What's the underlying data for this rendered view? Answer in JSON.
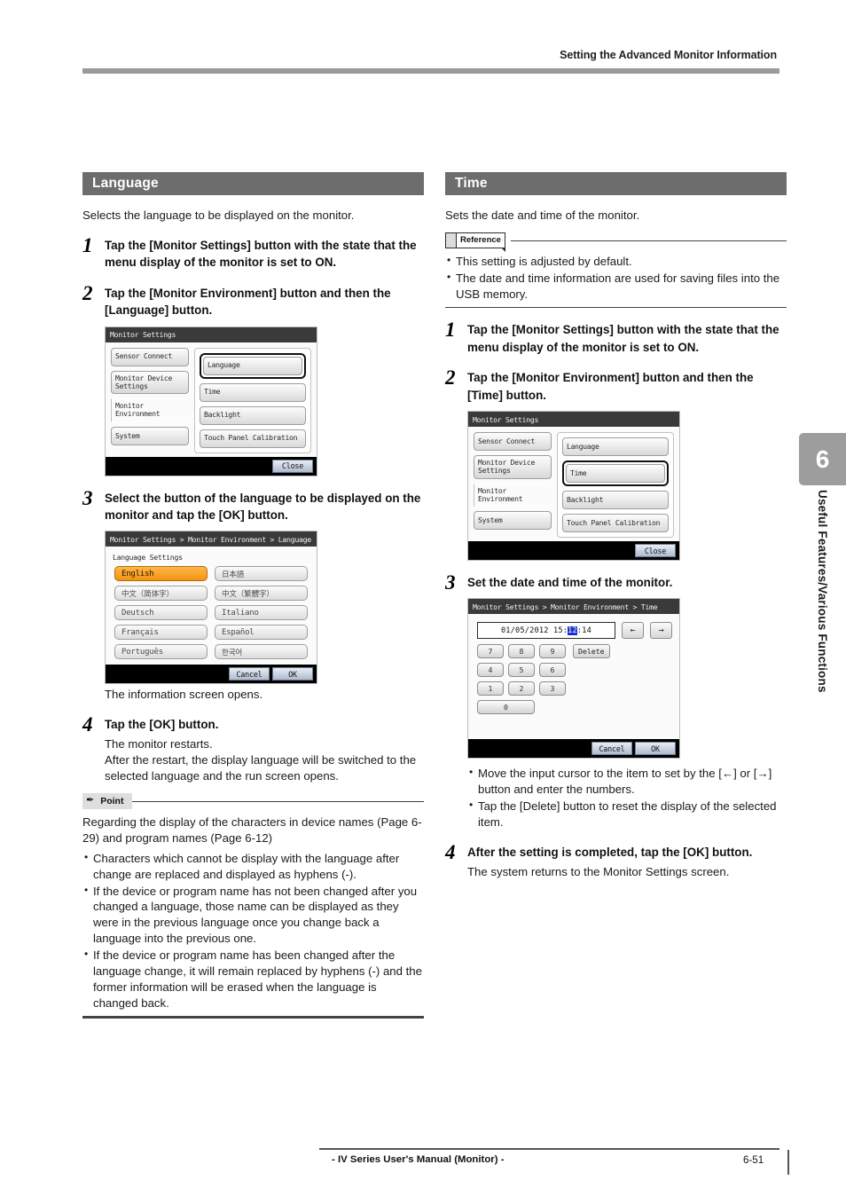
{
  "header": {
    "title": "Setting the Advanced Monitor Information"
  },
  "footer": {
    "center": "- IV Series User's Manual (Monitor) -",
    "page": "6-51"
  },
  "chapter_tab": {
    "number": "6",
    "label": "Useful Features/Various Functions"
  },
  "left": {
    "section_title": "Language",
    "intro": "Selects the language to be displayed on the monitor.",
    "steps": [
      {
        "num": "1",
        "title": "Tap the [Monitor Settings] button with the state that the menu display of the monitor is set to ON."
      },
      {
        "num": "2",
        "title": "Tap the [Monitor Environment] button and then the [Language] button."
      },
      {
        "num": "3",
        "title": "Select the button of the language to be displayed on the monitor and tap the [OK] button.",
        "after": "The information screen opens."
      },
      {
        "num": "4",
        "title": "Tap the [OK] button.",
        "body": "The monitor restarts.\nAfter the restart, the display language will be switched to the selected language and the run screen opens."
      }
    ],
    "point": {
      "tag": "Point",
      "icon": "pencil-icon",
      "paragraph": "Regarding the display of the characters in device names (Page 6-29) and program names (Page 6-12)",
      "bullets": [
        "Characters which cannot be display with the language after change are replaced and displayed as hyphens (-).",
        "If the device or program name has not been changed after you changed a language, those name can be displayed as they were in the previous language once you change back a language into the previous one.",
        "If the device or program name has been changed after the language change, it will remain replaced by hyphens (-) and the former information will be erased when the language is changed back."
      ]
    }
  },
  "right": {
    "section_title": "Time",
    "intro": "Sets the date and time of the monitor.",
    "reference": {
      "tag": "Reference",
      "bullets": [
        "This setting is adjusted by default.",
        "The date and time information are used for saving files into the USB memory."
      ]
    },
    "steps": [
      {
        "num": "1",
        "title": "Tap the [Monitor Settings] button with the state that the menu display of the monitor is set to ON."
      },
      {
        "num": "2",
        "title": "Tap the [Monitor Environment] button and then the [Time] button."
      },
      {
        "num": "3",
        "title": "Set the date and time of the monitor."
      },
      {
        "num": "4",
        "title": "After the setting is completed, tap the [OK] button.",
        "body": "The system returns to the Monitor Settings screen."
      }
    ],
    "time_notes": [
      "Move the input cursor to the item to set by the [←] or [→] button and enter the numbers.",
      "Tap the [Delete] button to reset the display of the selected item."
    ]
  },
  "device_menu": {
    "titlebar": "Monitor Settings",
    "left_buttons": [
      "Sensor Connect",
      "Monitor Device Settings",
      "Monitor Environment",
      "System"
    ],
    "right_buttons": [
      "Language",
      "Time",
      "Backlight",
      "Touch Panel Calibration"
    ],
    "close_label": "Close",
    "selected_left": "Monitor Environment",
    "selected_right_language": "Language",
    "selected_right_time": "Time"
  },
  "device_language": {
    "titlebar": "Monitor Settings > Monitor Environment > Language",
    "subtitle": "Language Settings",
    "options": [
      "English",
      "日本語",
      "中文（简体字）",
      "中文（繁體字）",
      "Deutsch",
      "Italiano",
      "Français",
      "Español",
      "Português",
      "한국어"
    ],
    "selected": "English",
    "cancel_label": "Cancel",
    "ok_label": "OK"
  },
  "device_time": {
    "titlebar": "Monitor Settings > Monitor Environment > Time",
    "value_prefix": "01/05/2012  15:",
    "value_cursor": "12",
    "value_suffix": ":14",
    "left_arrow": "←",
    "right_arrow": "→",
    "delete_label": "Delete",
    "keys": [
      "7",
      "8",
      "9",
      "4",
      "5",
      "6",
      "1",
      "2",
      "3"
    ],
    "key_zero": "0",
    "cancel_label": "Cancel",
    "ok_label": "OK"
  }
}
